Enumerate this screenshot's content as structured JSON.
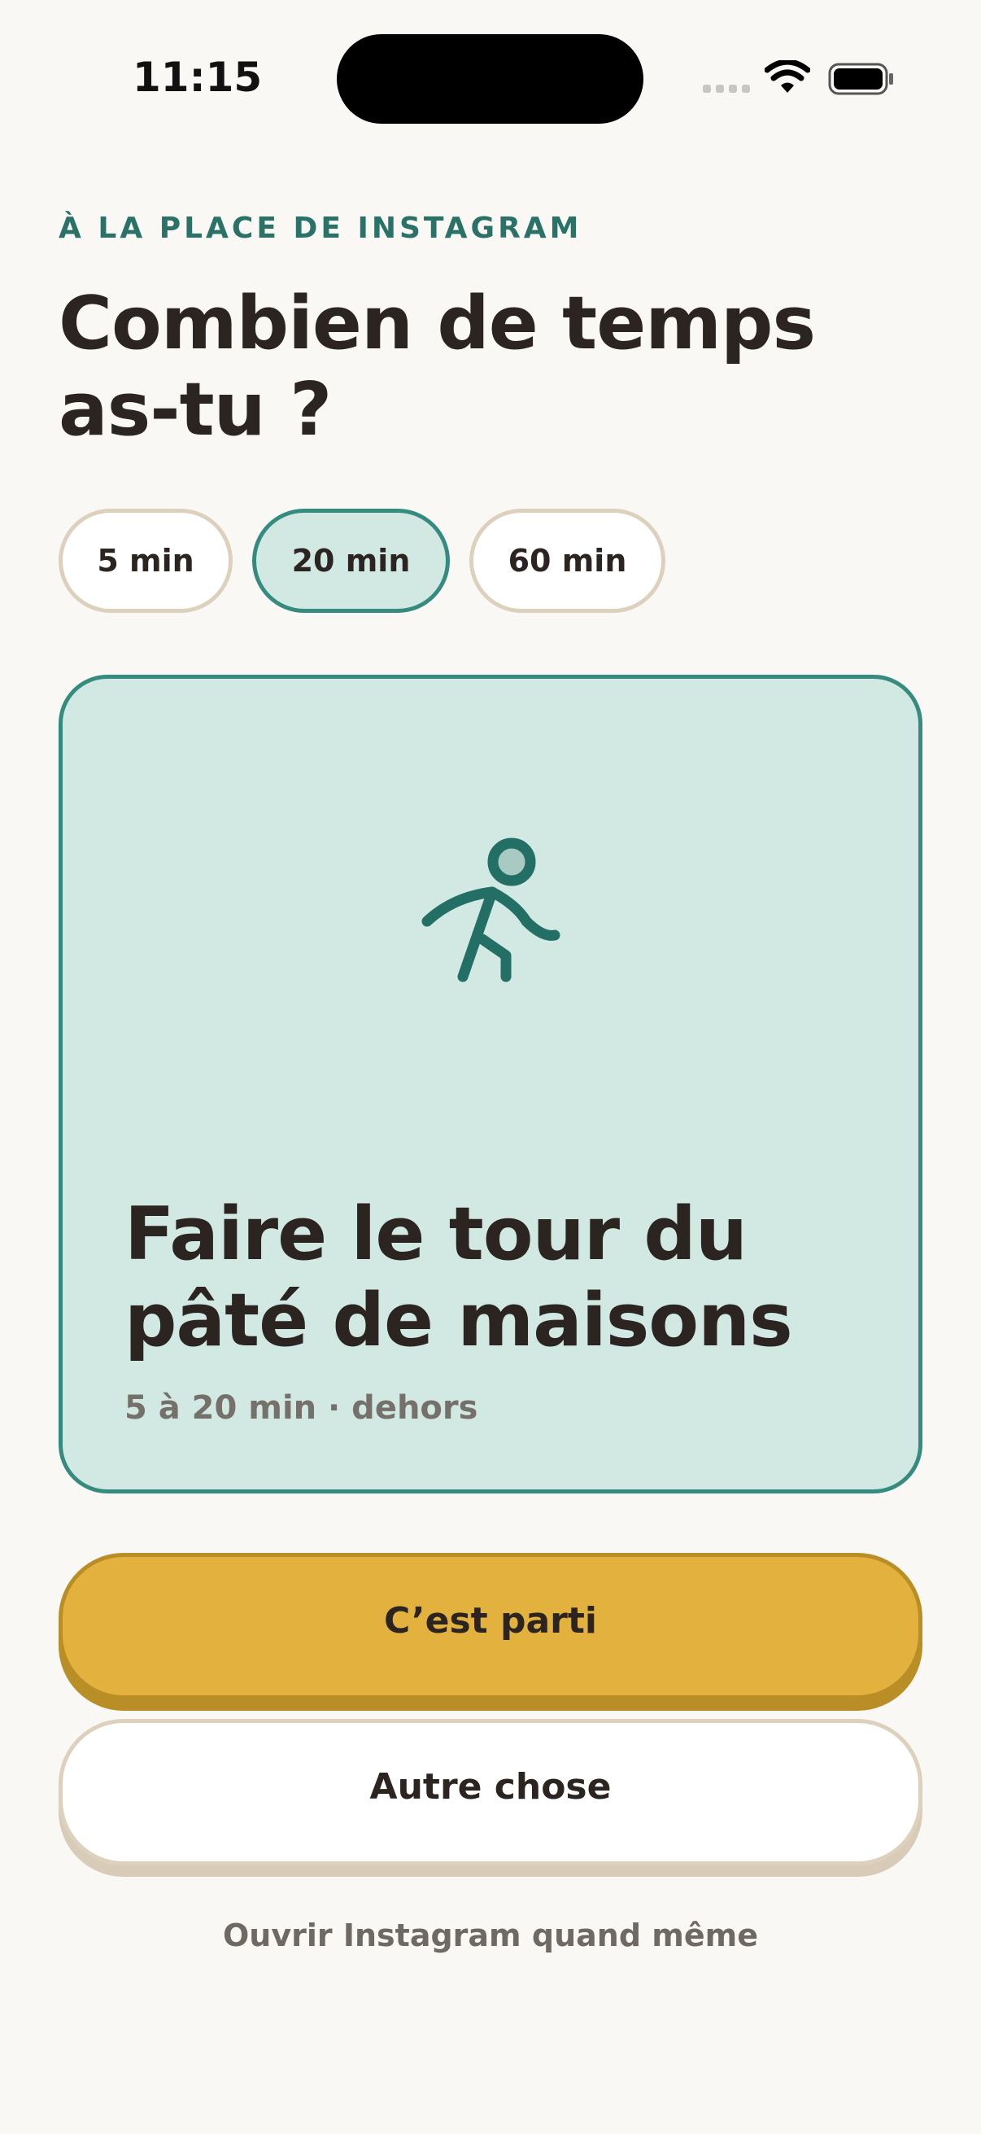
{
  "status_bar": {
    "time": "11:15"
  },
  "context_label": "À LA PLACE DE INSTAGRAM",
  "headline": "Combien de temps as-tu ?",
  "duration_options": [
    {
      "label": "5 min",
      "selected": false
    },
    {
      "label": "20 min",
      "selected": true
    },
    {
      "label": "60 min",
      "selected": false
    }
  ],
  "activity": {
    "icon": "walking-person-icon",
    "title": "Faire le tour du pâté de maisons",
    "meta": "5 à 20 min · dehors"
  },
  "actions": {
    "primary": "C’est parti",
    "secondary": "Autre chose",
    "link": "Ouvrir Instagram quand même"
  },
  "colors": {
    "background": "#faf8f4",
    "teal": "#2a7268",
    "teal_light": "#d2e8e3",
    "teal_border": "#368b80",
    "yellow": "#e3b13d",
    "text": "#2b2421"
  }
}
